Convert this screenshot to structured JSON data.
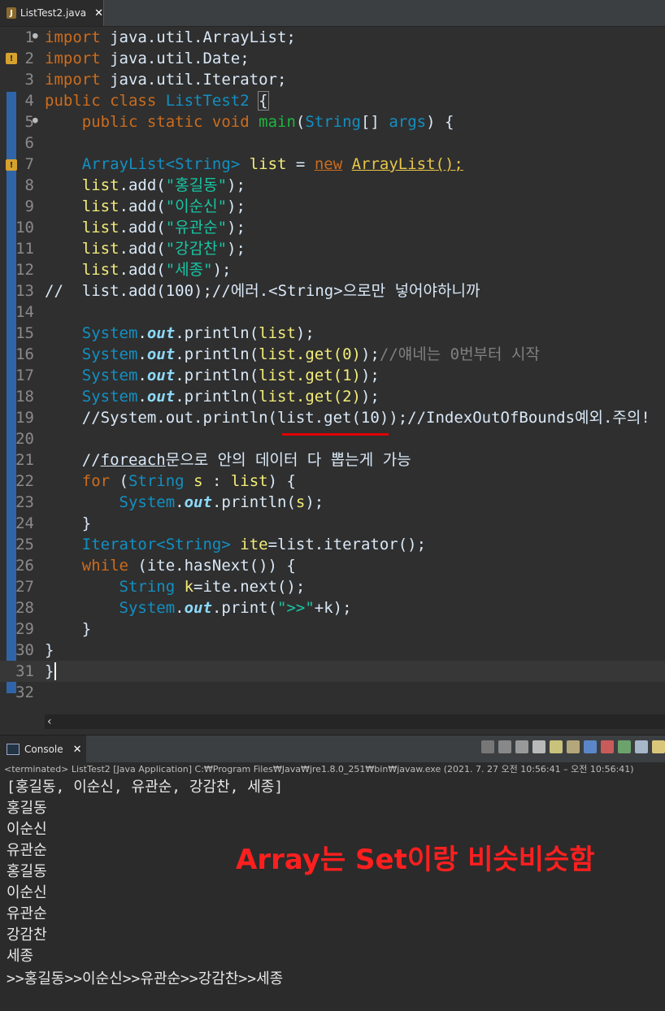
{
  "editor_tab": {
    "icon": "J",
    "filename": "ListTest2.java",
    "close": "✕"
  },
  "code": {
    "line_numbers": [
      "1",
      "2",
      "3",
      "4",
      "5",
      "6",
      "7",
      "8",
      "9",
      "10",
      "11",
      "12",
      "13",
      "14",
      "15",
      "16",
      "17",
      "18",
      "19",
      "20",
      "21",
      "22",
      "23",
      "24",
      "25",
      "26",
      "27",
      "28",
      "29",
      "30",
      "31",
      "32"
    ],
    "l1": {
      "kw": "import",
      "rest": " java.util.ArrayList;"
    },
    "l2": {
      "kw": "import",
      "rest": " java.util.Date;"
    },
    "l3": {
      "kw": "import",
      "rest": " java.util.Iterator;"
    },
    "l4": {
      "kw": "public class",
      "name": "ListTest2",
      "brace": "{"
    },
    "l5": {
      "kw": "public static void",
      "name": "main",
      "open": "(",
      "type": "String",
      "arr": "[] ",
      "param": "args",
      "close": ") {"
    },
    "l7": {
      "type1": "ArrayList",
      "lt": "<",
      "type2": "String",
      "gt": ">",
      "var": "list",
      "eq": " = ",
      "newkw": "new",
      "ctor": "ArrayList",
      "tail": "();"
    },
    "adds": [
      {
        "obj": "list",
        "call": ".add(",
        "str": "\"홍길동\"",
        "end": ");"
      },
      {
        "obj": "list",
        "call": ".add(",
        "str": "\"이순신\"",
        "end": ");"
      },
      {
        "obj": "list",
        "call": ".add(",
        "str": "\"유관순\"",
        "end": ");"
      },
      {
        "obj": "list",
        "call": ".add(",
        "str": "\"강감찬\"",
        "end": ");"
      },
      {
        "obj": "list",
        "call": ".add(",
        "str": "\"세종\"",
        "end": ");"
      }
    ],
    "l13": "//  list.add(100);//에러.<String>으로만 넣어야하니까",
    "prints": [
      {
        "sys": "System",
        "dot": ".",
        "out": "out",
        "call": ".println(",
        "arg": "list",
        "end": ");",
        "comment": ""
      },
      {
        "sys": "System",
        "dot": ".",
        "out": "out",
        "call": ".println(",
        "arg": "list.get(0)",
        "end": ");",
        "comment": "//얘네는 0번부터 시작"
      },
      {
        "sys": "System",
        "dot": ".",
        "out": "out",
        "call": ".println(",
        "arg": "list.get(1)",
        "end": ");",
        "comment": ""
      },
      {
        "sys": "System",
        "dot": ".",
        "out": "out",
        "call": ".println(",
        "arg": "list.get(2)",
        "end": ");",
        "comment": ""
      }
    ],
    "l19": "//System.out.println(list.get(10));//IndexOutOfBounds예외.주의!",
    "l21_a": "//",
    "l21_b": "foreach",
    "l21_c": "문으로 안의 데이터 다 뽑는게 가능",
    "l22": {
      "kw": "for",
      "a": " (",
      "type": "String",
      "v": " s",
      "b": " : ",
      "obj": "list",
      "c": ") {"
    },
    "l23": {
      "sys": "System",
      "dot": ".",
      "out": "out",
      "call": ".println(",
      "arg": "s",
      "end": ");"
    },
    "l24": "}",
    "l25": {
      "type": "Iterator",
      "lt": "<",
      "type2": "String",
      "gt": ">",
      "v": " ite",
      "rest": "=list.iterator();"
    },
    "l26": {
      "kw": "while",
      "rest": " (ite.hasNext()) {"
    },
    "l27": {
      "type": "String",
      "v": " k",
      "rest": "=ite.next();"
    },
    "l28": {
      "sys": "System",
      "dot": ".",
      "out": "out",
      "call": ".print(",
      "str": "\">>\"",
      "rest": "+k);"
    },
    "l29": "}",
    "l30": "}",
    "l31": "}"
  },
  "console_tab": {
    "label": "Console",
    "close": "✕"
  },
  "console_status": "<terminated> ListTest2 [Java Application] C:₩Program Files₩Java₩jre1.8.0_251₩bin₩javaw.exe  (2021. 7. 27 오전 10:56:41 – 오전 10:56:41)",
  "console_output": [
    "[홍길동, 이순신, 유관순, 강감찬, 세종]",
    "홍길동",
    "이순신",
    "유관순",
    "홍길동",
    "이순신",
    "유관순",
    "강감찬",
    "세종",
    ">>홍길동>>이순신>>유관순>>강감찬>>세종"
  ],
  "annotation": "Array는 Set이랑 비슷비슷함",
  "colors": {
    "keyword": "#cc6c1d",
    "type": "#1290c3",
    "string": "#17c6a3",
    "comment": "#808080",
    "annotation": "#ff1f1f"
  }
}
